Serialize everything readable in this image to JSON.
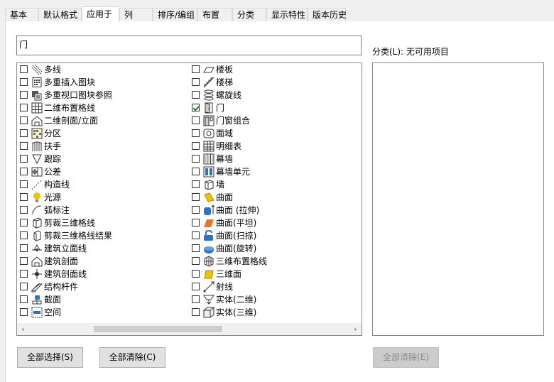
{
  "tabs": [
    {
      "label": "基本"
    },
    {
      "label": "默认格式"
    },
    {
      "label": "应用于"
    },
    {
      "label": "列"
    },
    {
      "label": "排序/编组"
    },
    {
      "label": "布置"
    },
    {
      "label": "分类"
    },
    {
      "label": "显示特性"
    },
    {
      "label": "版本历史"
    }
  ],
  "active_tab": "应用于",
  "search": {
    "value": "门"
  },
  "objects_left": [
    {
      "label": "多线",
      "checked": false,
      "icon": "multiline-icon"
    },
    {
      "label": "多重插入图块",
      "checked": false,
      "icon": "multi-insert-block-icon"
    },
    {
      "label": "多重视口图块参照",
      "checked": false,
      "icon": "multi-view-block-ref-icon"
    },
    {
      "label": "二维布置格线",
      "checked": false,
      "icon": "2d-layout-grid-icon"
    },
    {
      "label": "二维剖面/立面",
      "checked": false,
      "icon": "2d-section-elevation-icon"
    },
    {
      "label": "分区",
      "checked": false,
      "icon": "zone-icon"
    },
    {
      "label": "扶手",
      "checked": false,
      "icon": "railing-icon"
    },
    {
      "label": "跟踪",
      "checked": false,
      "icon": "trace-icon"
    },
    {
      "label": "公差",
      "checked": false,
      "icon": "tolerance-icon"
    },
    {
      "label": "构造线",
      "checked": false,
      "icon": "construction-line-icon"
    },
    {
      "label": "光源",
      "checked": false,
      "icon": "light-icon"
    },
    {
      "label": "弧标注",
      "checked": false,
      "icon": "arc-dimension-icon"
    },
    {
      "label": "剪裁三维格线",
      "checked": false,
      "icon": "clip-3d-grid-icon"
    },
    {
      "label": "剪裁三维格线结果",
      "checked": false,
      "icon": "clip-3d-grid-result-icon"
    },
    {
      "label": "建筑立面线",
      "checked": false,
      "icon": "building-elevation-line-icon"
    },
    {
      "label": "建筑剖面",
      "checked": false,
      "icon": "building-section-icon"
    },
    {
      "label": "建筑剖面线",
      "checked": false,
      "icon": "building-section-line-icon"
    },
    {
      "label": "结构杆件",
      "checked": false,
      "icon": "structural-member-icon"
    },
    {
      "label": "截面",
      "checked": false,
      "icon": "section-icon"
    },
    {
      "label": "空间",
      "checked": false,
      "icon": "space-icon"
    }
  ],
  "objects_right": [
    {
      "label": "楼板",
      "checked": false,
      "icon": "slab-icon"
    },
    {
      "label": "楼梯",
      "checked": false,
      "icon": "stair-icon"
    },
    {
      "label": "螺旋线",
      "checked": false,
      "icon": "helix-icon"
    },
    {
      "label": "门",
      "checked": true,
      "icon": "door-icon"
    },
    {
      "label": "门窗组合",
      "checked": false,
      "icon": "door-window-assembly-icon"
    },
    {
      "label": "面域",
      "checked": false,
      "icon": "region-icon"
    },
    {
      "label": "明细表",
      "checked": false,
      "icon": "schedule-table-icon"
    },
    {
      "label": "幕墙",
      "checked": false,
      "icon": "curtain-wall-icon"
    },
    {
      "label": "幕墙单元",
      "checked": false,
      "icon": "curtain-wall-unit-icon"
    },
    {
      "label": "墙",
      "checked": false,
      "icon": "wall-icon"
    },
    {
      "label": "曲面",
      "checked": false,
      "icon": "surface-icon"
    },
    {
      "label": "曲面 (拉伸)",
      "checked": false,
      "icon": "surface-extrude-icon"
    },
    {
      "label": "曲面(平坦)",
      "checked": false,
      "icon": "surface-planar-icon"
    },
    {
      "label": "曲面(扫掠)",
      "checked": false,
      "icon": "surface-sweep-icon"
    },
    {
      "label": "曲面(旋转)",
      "checked": false,
      "icon": "surface-revolve-icon"
    },
    {
      "label": "三维布置格线",
      "checked": false,
      "icon": "3d-layout-grid-icon"
    },
    {
      "label": "三维面",
      "checked": false,
      "icon": "3d-face-icon"
    },
    {
      "label": "射线",
      "checked": false,
      "icon": "ray-icon"
    },
    {
      "label": "实体(二维)",
      "checked": false,
      "icon": "solid-2d-icon"
    },
    {
      "label": "实体(三维)",
      "checked": false,
      "icon": "solid-3d-icon"
    }
  ],
  "classification": {
    "label": "分类(L): 无可用项目"
  },
  "buttons": {
    "select_all": "全部选择(S)",
    "clear_all": "全部清除(C)",
    "clear_all_classification": "全部清除(E)"
  },
  "colors": {
    "accent_blue": "#2a73c8",
    "check_green": "#1a7f3c",
    "yellow": "#f2c200"
  }
}
